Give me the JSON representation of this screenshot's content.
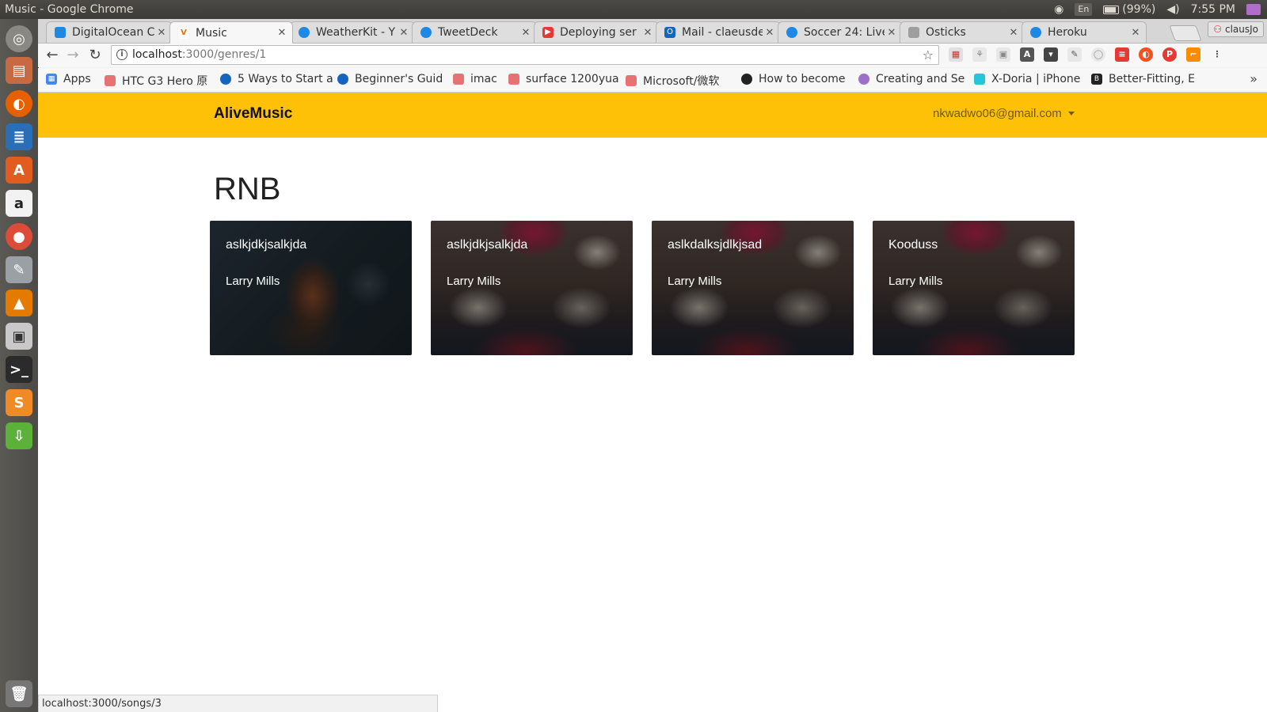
{
  "os": {
    "window_title": "Music - Google Chrome",
    "lang": "En",
    "battery": "(99%)",
    "clock": "7:55 PM",
    "launcher_icons": [
      "ubuntu-dash-icon",
      "files-icon",
      "firefox-icon",
      "writer-icon",
      "software-center-icon",
      "amazon-icon",
      "chrome-icon",
      "system-settings-icon",
      "vlc-icon",
      "disk-icon",
      "terminal-icon",
      "sublime-text-icon",
      "install-icon",
      "trash-icon"
    ]
  },
  "chrome": {
    "tabs": [
      {
        "label": "DigitalOcean C",
        "favicon_color": "#1e88e5"
      },
      {
        "label": "Music",
        "favicon_color": "#ffffff"
      },
      {
        "label": "WeatherKit - Y",
        "favicon_color": "#1e88e5"
      },
      {
        "label": "TweetDeck",
        "favicon_color": "#1e88e5"
      },
      {
        "label": "Deploying ser",
        "favicon_color": "#e53935"
      },
      {
        "label": "Mail - claeusde",
        "favicon_color": "#1565c0"
      },
      {
        "label": "Soccer 24: Live",
        "favicon_color": "#1e88e5"
      },
      {
        "label": "Osticks",
        "favicon_color": "#9e9e9e"
      },
      {
        "label": "Heroku",
        "favicon_color": "#1e88e5"
      }
    ],
    "profile": "clausJo",
    "url_host": "localhost",
    "url_path": ":3000/genres/1",
    "bookmarks": [
      {
        "label": "Apps"
      },
      {
        "label": "HTC G3 Hero 原"
      },
      {
        "label": "5 Ways to Start a"
      },
      {
        "label": "Beginner's Guid"
      },
      {
        "label": "imac"
      },
      {
        "label": "surface 1200yua"
      },
      {
        "label": "Microsoft/微软"
      },
      {
        "label": "How to become"
      },
      {
        "label": "Creating and Se"
      },
      {
        "label": "X-Doria | iPhone"
      },
      {
        "label": "Better-Fitting, E"
      }
    ],
    "bookmarks_overflow": "»",
    "status_url": "localhost:3000/songs/3"
  },
  "page": {
    "brand": "AliveMusic",
    "user_email": "nkwadwo06@gmail.com",
    "genre_title": "RNB",
    "accent": "#ffc107",
    "songs": [
      {
        "title": "aslkjdkjsalkjda",
        "artist": "Larry Mills"
      },
      {
        "title": "aslkjdkjsalkjda",
        "artist": "Larry Mills"
      },
      {
        "title": "aslkdalksjdlkjsad",
        "artist": "Larry Mills"
      },
      {
        "title": "Kooduss",
        "artist": "Larry Mills"
      }
    ]
  }
}
